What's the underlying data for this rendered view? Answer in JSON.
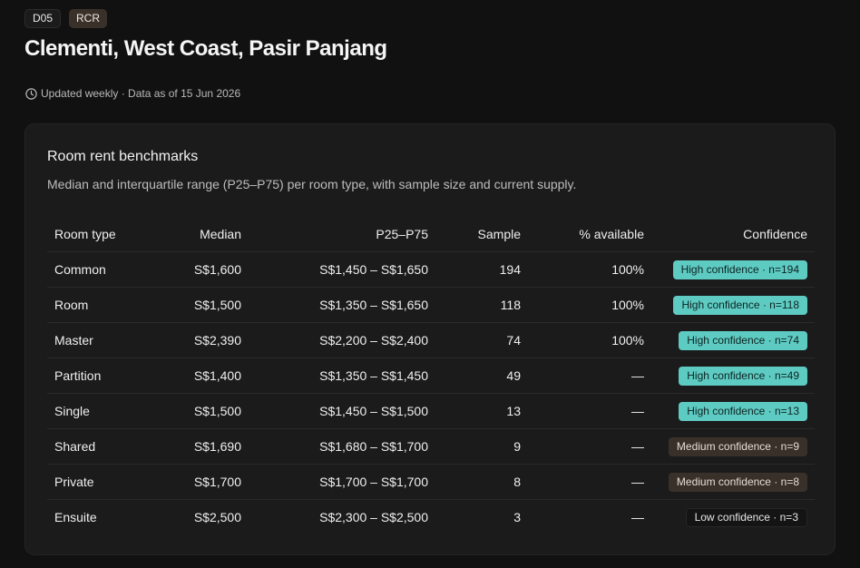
{
  "header": {
    "district_tag": "D05",
    "region_tag": "RCR",
    "title": "Clementi, West Coast, Pasir Panjang",
    "updated_text": "Updated weekly · Data as of 15 Jun 2026"
  },
  "card": {
    "title": "Room rent benchmarks",
    "description": "Median and interquartile range (P25–P75) per room type, with sample size and current supply.",
    "columns": {
      "room_type": "Room type",
      "median": "Median",
      "range": "P25–P75",
      "sample": "Sample",
      "available": "% available",
      "confidence": "Confidence"
    },
    "rows": [
      {
        "room_type": "Common",
        "median": "S$1,600",
        "range": "S$1,450 – S$1,650",
        "sample": "194",
        "available": "100%",
        "confidence": "High confidence · n=194",
        "level": "high"
      },
      {
        "room_type": "Room",
        "median": "S$1,500",
        "range": "S$1,350 – S$1,650",
        "sample": "118",
        "available": "100%",
        "confidence": "High confidence · n=118",
        "level": "high"
      },
      {
        "room_type": "Master",
        "median": "S$2,390",
        "range": "S$2,200 – S$2,400",
        "sample": "74",
        "available": "100%",
        "confidence": "High confidence · n=74",
        "level": "high"
      },
      {
        "room_type": "Partition",
        "median": "S$1,400",
        "range": "S$1,350 – S$1,450",
        "sample": "49",
        "available": "—",
        "confidence": "High confidence · n=49",
        "level": "high"
      },
      {
        "room_type": "Single",
        "median": "S$1,500",
        "range": "S$1,450 – S$1,500",
        "sample": "13",
        "available": "—",
        "confidence": "High confidence · n=13",
        "level": "high"
      },
      {
        "room_type": "Shared",
        "median": "S$1,690",
        "range": "S$1,680 – S$1,700",
        "sample": "9",
        "available": "—",
        "confidence": "Medium confidence · n=9",
        "level": "medium"
      },
      {
        "room_type": "Private",
        "median": "S$1,700",
        "range": "S$1,700 – S$1,700",
        "sample": "8",
        "available": "—",
        "confidence": "Medium confidence · n=8",
        "level": "medium"
      },
      {
        "room_type": "Ensuite",
        "median": "S$2,500",
        "range": "S$2,300 – S$2,500",
        "sample": "3",
        "available": "—",
        "confidence": "Low confidence · n=3",
        "level": "low"
      }
    ]
  },
  "icons": {
    "updated": "clock-icon"
  },
  "colors": {
    "background": "#111111",
    "card": "#1b1b1b",
    "high_badge": "#5ecbc3",
    "medium_badge": "#3a302a",
    "low_badge": "#141414"
  }
}
